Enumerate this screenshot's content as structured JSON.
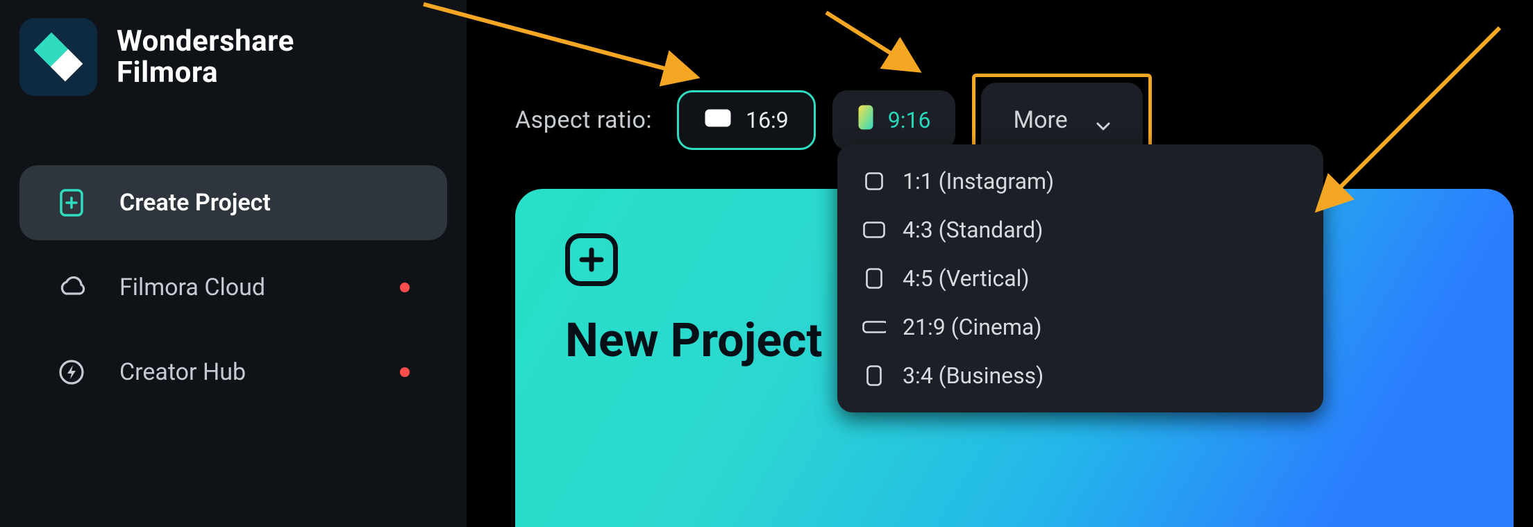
{
  "brand": {
    "line1": "Wondershare",
    "line2": "Filmora"
  },
  "sidebar": {
    "items": [
      {
        "label": "Create Project",
        "active": true
      },
      {
        "label": "Filmora Cloud",
        "dot": true
      },
      {
        "label": "Creator Hub",
        "dot": true
      }
    ]
  },
  "aspect_ratio": {
    "label": "Aspect ratio:",
    "selected": "16:9",
    "alt": "9:16",
    "more_label": "More",
    "more_options": [
      "1:1 (Instagram)",
      "4:3 (Standard)",
      "4:5 (Vertical)",
      "21:9 (Cinema)",
      "3:4 (Business)"
    ]
  },
  "card": {
    "title": "New Project"
  },
  "colors": {
    "accent": "#2fdcc0",
    "highlight": "#f5a623",
    "dot": "#ff4d4d"
  }
}
